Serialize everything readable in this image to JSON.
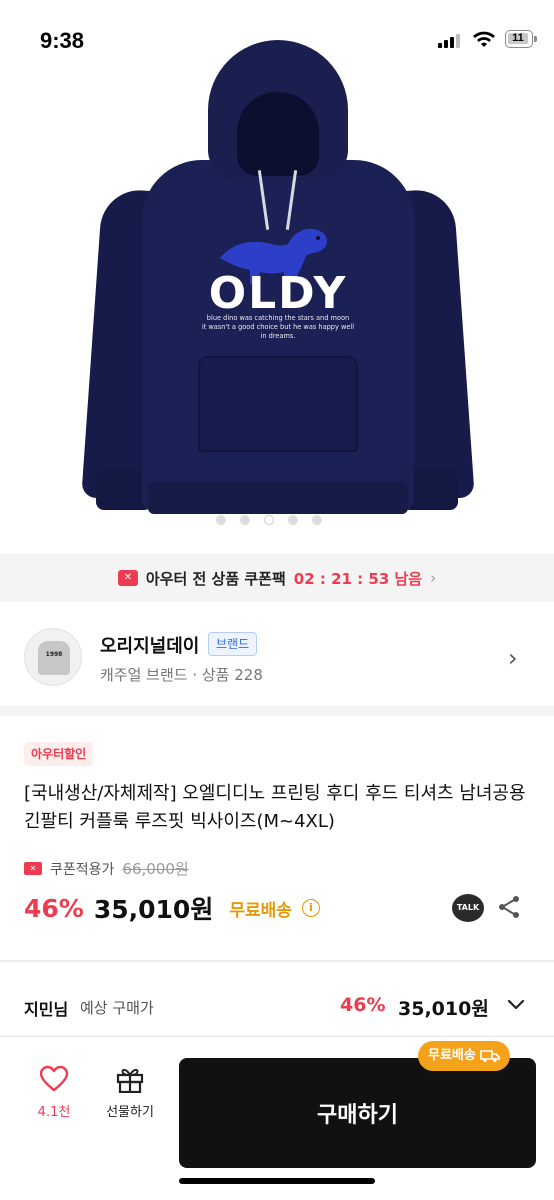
{
  "status_bar": {
    "time": "9:38",
    "battery": "11"
  },
  "nav": {
    "back_icon": "chevron-left-icon",
    "home_icon": "home-icon",
    "search_icon": "search-icon",
    "bag_icon": "shopping-bag-icon"
  },
  "hero": {
    "print_title": "OLDY",
    "print_line_1": "blue dino was catching the stars and moon",
    "print_line_2": "it wasn't a good choice but he was happy well",
    "print_line_3": "in dreams.",
    "carousel_total": 5,
    "carousel_active_index": 2
  },
  "coupon_banner": {
    "text": "아우터 전 상품 쿠폰팩",
    "timer": "02 : 21 : 53 남음"
  },
  "brand": {
    "name": "오리지널데이",
    "badge": "브랜드",
    "sub": "캐주얼 브랜드 · 상품 228",
    "avatar_text": "1998"
  },
  "product": {
    "sale_tag": "아우터할인",
    "title": "[국내생산/자체제작] 오엘디디노 프린팅 후디 후드 티셔츠 남녀공용 긴팔티 커플룩 루즈핏 빅사이즈(M~4XL)",
    "coupon_price_label": "쿠폰적용가",
    "original_price": "66,000원",
    "discount": "46%",
    "price": "35,010원",
    "free_shipping": "무료배송"
  },
  "estimate": {
    "name": "지민님",
    "label": "예상 구매가",
    "discount": "46%",
    "price": "35,010원"
  },
  "bottom_bar": {
    "like_count": "4.1천",
    "gift_label": "선물하기",
    "buy_label": "구매하기",
    "ship_badge": "무료배송"
  },
  "colors": {
    "accent_red": "#ef3b4f",
    "shipping_orange": "#e29a09",
    "badge_orange": "#f4a21a",
    "hoodie_navy": "#1b2154"
  }
}
